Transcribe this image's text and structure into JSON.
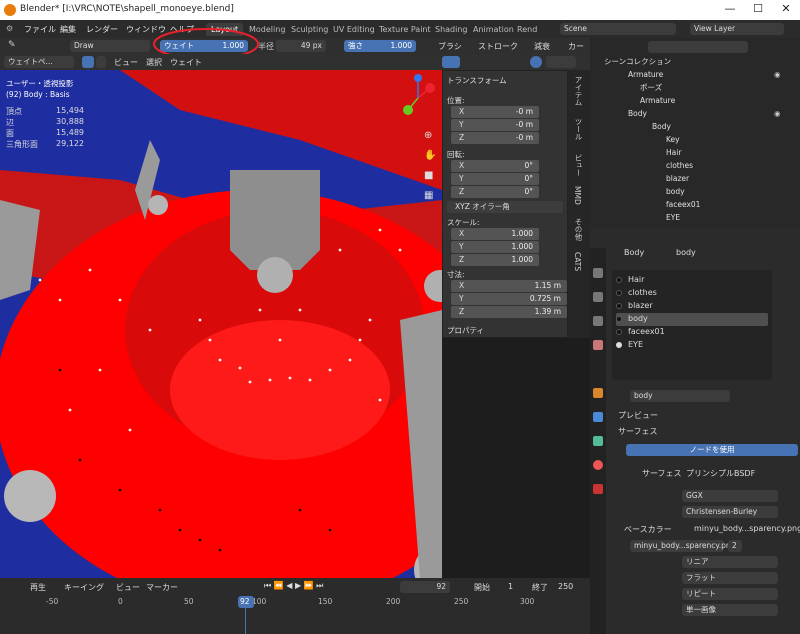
{
  "window": {
    "title": "Blender* [I:\\VRC\\NOTE\\shapell_monoeye.blend]",
    "min": "—",
    "max": "☐",
    "close": "✕"
  },
  "menu": [
    "ファイル",
    "編集",
    "レンダー",
    "ウィンドウ",
    "ヘルプ"
  ],
  "tabs": [
    "Layout",
    "Modeling",
    "Sculpting",
    "UV Editing",
    "Texture Paint",
    "Shading",
    "Animation",
    "Rend"
  ],
  "scene": "Scene",
  "view_layer": "View Layer",
  "tool": {
    "brush": "Draw",
    "weight_label": "ウェイト",
    "weight_val": "1.000",
    "radius_label": "半径",
    "radius_val": "49 px",
    "strength_label": "強さ",
    "strength_val": "1.000",
    "brush_menu": "ブラシ",
    "stroke_menu": "ストローク",
    "falloff_menu": "減衰",
    "more": "カー"
  },
  "header": {
    "mode": "ウェイトペ...",
    "view": "ビュー",
    "select": "選択",
    "weight": "ウェイト"
  },
  "overlay": {
    "persp": "ユーザー・透視投影",
    "obj": "(92) Body : Basis",
    "stats": [
      [
        "頂点",
        "15,494"
      ],
      [
        "辺",
        "30,888"
      ],
      [
        "面",
        "15,489"
      ],
      [
        "三角形面",
        "29,122"
      ]
    ]
  },
  "npanel": {
    "title": "トランスフォーム",
    "loc": "位置:",
    "rot": "回転:",
    "scale": "スケール:",
    "dim": "寸法:",
    "mode": "XYZ オイラー角",
    "props": "プロパティ",
    "loc_v": [
      [
        "X",
        "-0 m"
      ],
      [
        "Y",
        "-0 m"
      ],
      [
        "Z",
        "-0 m"
      ]
    ],
    "rot_v": [
      [
        "X",
        "0°"
      ],
      [
        "Y",
        "0°"
      ],
      [
        "Z",
        "0°"
      ]
    ],
    "scale_v": [
      [
        "X",
        "1.000"
      ],
      [
        "Y",
        "1.000"
      ],
      [
        "Z",
        "1.000"
      ]
    ],
    "dim_v": [
      [
        "X",
        "1.15 m"
      ],
      [
        "Y",
        "0.725 m"
      ],
      [
        "Z",
        "1.39 m"
      ]
    ]
  },
  "ntabs": [
    "アイテム",
    "ツール",
    "ビュー",
    "MMD",
    "その他",
    "CATS"
  ],
  "outliner": {
    "title": "シーンコレクション",
    "rows": [
      {
        "label": "Armature",
        "indent": 1
      },
      {
        "label": "ポーズ",
        "indent": 2
      },
      {
        "label": "Armature",
        "indent": 2
      },
      {
        "label": "Body",
        "indent": 1
      },
      {
        "label": "Body",
        "indent": 2
      },
      {
        "label": "Key",
        "indent": 3
      },
      {
        "label": "Hair",
        "indent": 3
      },
      {
        "label": "clothes",
        "indent": 3
      },
      {
        "label": "blazer",
        "indent": 3
      },
      {
        "label": "body",
        "indent": 3
      },
      {
        "label": "faceex01",
        "indent": 3
      },
      {
        "label": "EYE",
        "indent": 3
      }
    ]
  },
  "props": {
    "crumb1": "Body",
    "crumb2": "body",
    "materials": [
      "Hair",
      "clothes",
      "blazer",
      "body",
      "faceex01",
      "EYE"
    ],
    "selected_index": 3,
    "mat_name": "body",
    "preview": "プレビュー",
    "surface": "サーフェス",
    "use_nodes": "ノードを使用",
    "surface_label": "サーフェス",
    "surface_val": "プリンシプルBSDF",
    "ggx": "GGX",
    "cb": "Christensen-Burley",
    "base_color": "ベースカラー",
    "tex1": "minyu_body...sparency.png",
    "tex2": "minyu_body...sparency.png",
    "users": "2",
    "linear": "リニア",
    "flat": "フラット",
    "repeat": "リピート",
    "single": "単一画像"
  },
  "timeline": {
    "play": "再生",
    "keying": "キーイング",
    "view": "ビュー",
    "marker": "マーカー",
    "frame": "92",
    "start_label": "開始",
    "start": "1",
    "end_label": "終了",
    "end": "250",
    "ticks": [
      "-50",
      "0",
      "50",
      "100",
      "150",
      "200",
      "250",
      "300"
    ],
    "cursor": "92"
  },
  "colors": {
    "accent": "#4772b3",
    "red": "#ff0000",
    "blue": "#1e2ea0"
  }
}
